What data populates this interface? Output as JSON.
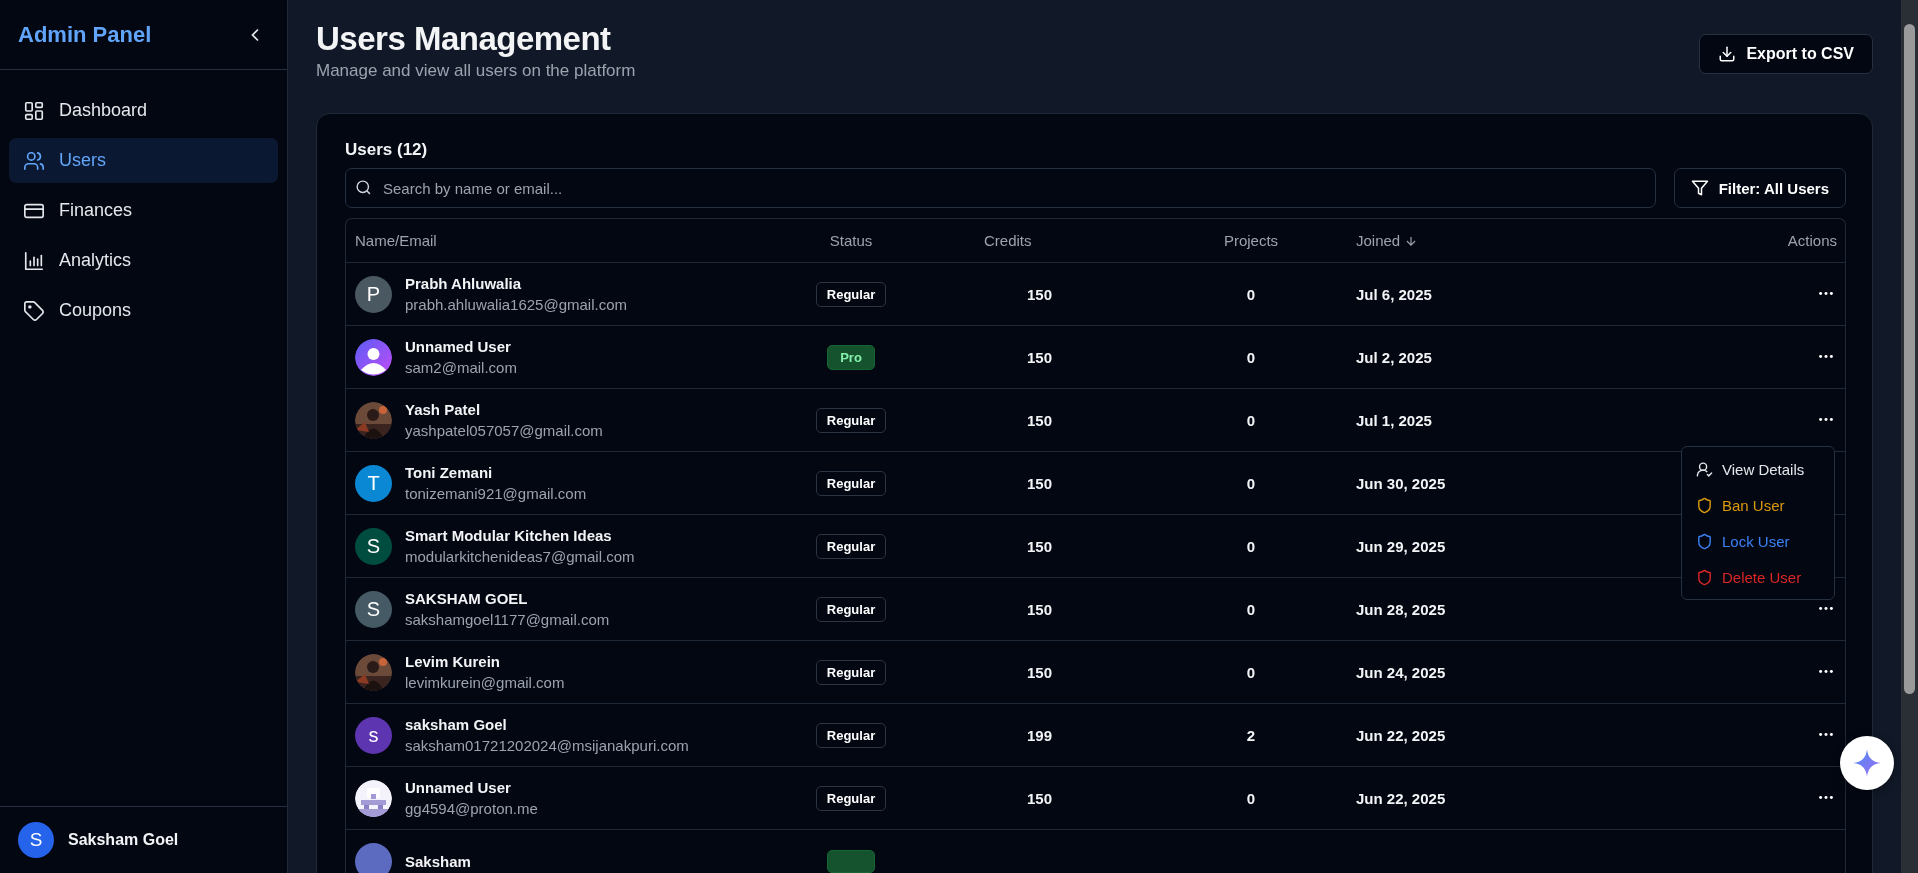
{
  "sidebar": {
    "title": "Admin Panel",
    "items": [
      {
        "label": "Dashboard",
        "selected": false
      },
      {
        "label": "Users",
        "selected": true
      },
      {
        "label": "Finances",
        "selected": false
      },
      {
        "label": "Analytics",
        "selected": false
      },
      {
        "label": "Coupons",
        "selected": false
      }
    ],
    "user": {
      "initial": "S",
      "name": "Saksham Goel"
    }
  },
  "header": {
    "title": "Users Management",
    "subtitle": "Manage and view all users on the platform",
    "export_button": "Export to CSV"
  },
  "users_card": {
    "title": "Users (12)",
    "search": {
      "placeholder": "Search by name or email..."
    },
    "filter_button": "Filter: All Users",
    "table": {
      "columns": [
        {
          "label": "Name/Email",
          "sorted": false
        },
        {
          "label": "Status",
          "sorted": false
        },
        {
          "label": "Credits",
          "sorted": false
        },
        {
          "label": "Projects",
          "sorted": false
        },
        {
          "label": "Joined",
          "sorted": true
        },
        {
          "label": "Actions",
          "sorted": false
        }
      ],
      "rows": [
        {
          "name": "Prabh Ahluwalia",
          "email": "prabh.ahluwalia1625@gmail.com",
          "avatar": {
            "kind": "letter",
            "initial": "P",
            "color": "#4a5862"
          },
          "status": {
            "kind": "regular",
            "label": "Regular"
          },
          "credits": "150",
          "projects": "0",
          "joined": "Jul 6, 2025"
        },
        {
          "name": "Unnamed User",
          "email": "sam2@mail.com",
          "avatar": {
            "kind": "person"
          },
          "status": {
            "kind": "pro",
            "label": "Pro"
          },
          "credits": "150",
          "projects": "0",
          "joined": "Jul 2, 2025"
        },
        {
          "name": "Yash Patel",
          "email": "yashpatel057057@gmail.com",
          "avatar": {
            "kind": "picture"
          },
          "status": {
            "kind": "regular",
            "label": "Regular"
          },
          "credits": "150",
          "projects": "0",
          "joined": "Jul 1, 2025",
          "menu": [
            {
              "kind": "view",
              "label": "View Details"
            },
            {
              "kind": "ban",
              "label": "Ban User"
            },
            {
              "kind": "lock",
              "label": "Lock User"
            },
            {
              "kind": "delete",
              "label": "Delete User"
            }
          ]
        },
        {
          "name": "Toni Zemani",
          "email": "tonizemani921@gmail.com",
          "avatar": {
            "kind": "letter",
            "initial": "T",
            "color": "#0a88d4"
          },
          "status": {
            "kind": "regular",
            "label": "Regular"
          },
          "credits": "150",
          "projects": "0",
          "joined": "Jun 30, 2025"
        },
        {
          "name": "Smart Modular Kitchen Ideas",
          "email": "modularkitchenideas7@gmail.com",
          "avatar": {
            "kind": "letter",
            "initial": "S",
            "color": "#004d40"
          },
          "status": {
            "kind": "regular",
            "label": "Regular"
          },
          "credits": "150",
          "projects": "0",
          "joined": "Jun 29, 2025"
        },
        {
          "name": "SAKSHAM GOEL",
          "email": "sakshamgoel1177@gmail.com",
          "avatar": {
            "kind": "letter",
            "initial": "S",
            "color": "#455a64"
          },
          "status": {
            "kind": "regular",
            "label": "Regular"
          },
          "credits": "150",
          "projects": "0",
          "joined": "Jun 28, 2025"
        },
        {
          "name": "Levim Kurein",
          "email": "levimkurein@gmail.com",
          "avatar": {
            "kind": "picture"
          },
          "status": {
            "kind": "regular",
            "label": "Regular"
          },
          "credits": "150",
          "projects": "0",
          "joined": "Jun 24, 2025"
        },
        {
          "name": "saksham Goel",
          "email": "saksham01721202024@msijanakpuri.com",
          "avatar": {
            "kind": "letter",
            "initial": "s",
            "color": "#5e35b1"
          },
          "status": {
            "kind": "regular",
            "label": "Regular"
          },
          "credits": "199",
          "projects": "2",
          "joined": "Jun 22, 2025"
        },
        {
          "name": "Unnamed User",
          "email": "gg4594@proton.me",
          "avatar": {
            "kind": "pixel"
          },
          "status": {
            "kind": "regular",
            "label": "Regular"
          },
          "credits": "150",
          "projects": "0",
          "joined": "Jun 22, 2025"
        },
        {
          "name": "Saksham",
          "avatar": {
            "kind": "letter",
            "color": "#5c6bc0"
          },
          "status": {
            "kind": "pro"
          }
        }
      ]
    }
  }
}
